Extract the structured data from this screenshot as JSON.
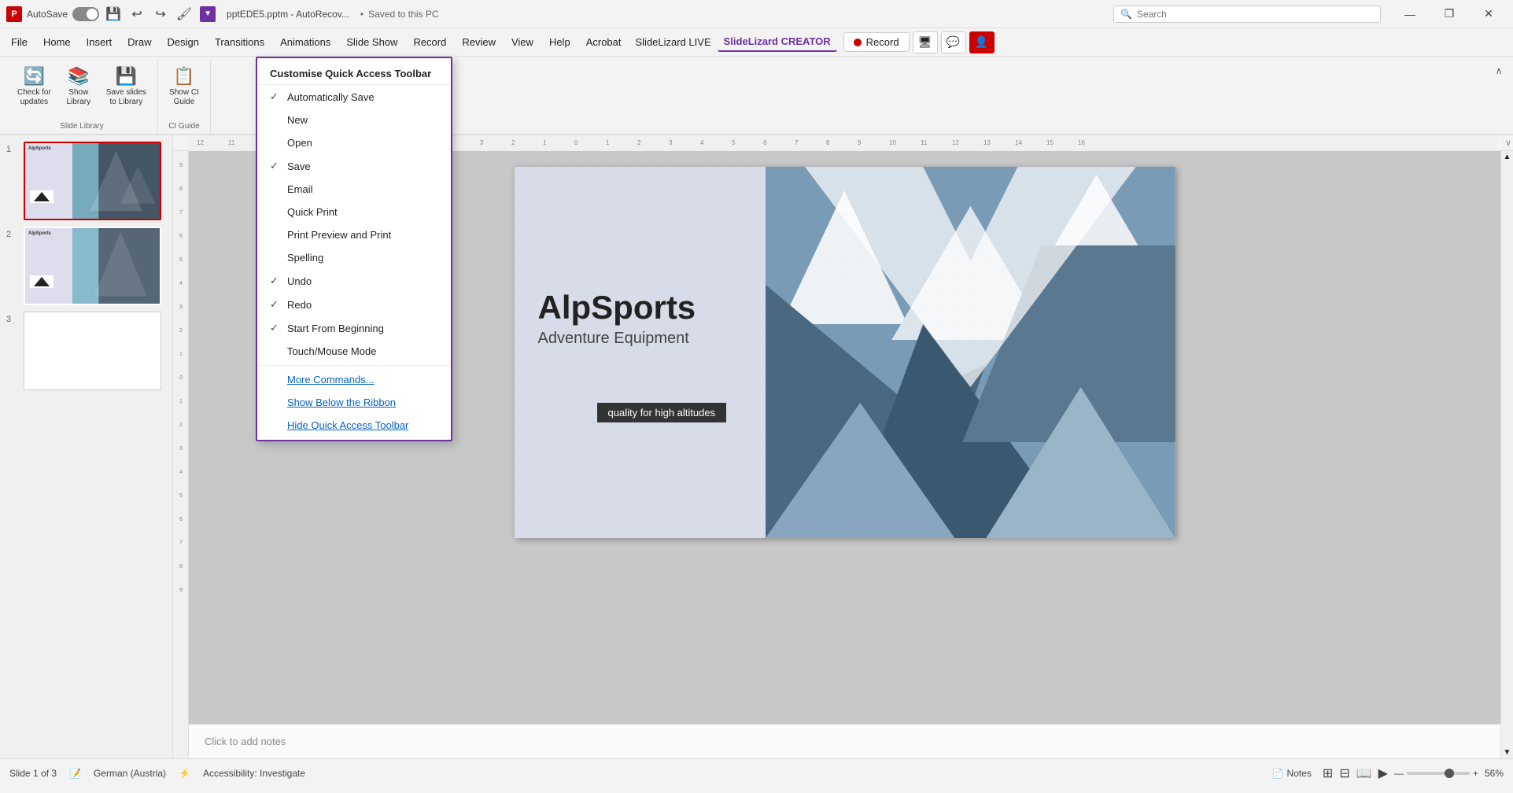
{
  "titleBar": {
    "appIcon": "P",
    "autosaveLabel": "AutoSave",
    "toggleState": "on",
    "saveIcon": "💾",
    "undoIcon": "↩",
    "redoIcon": "↪",
    "formatPainterIcon": "🖌",
    "dropdownIcon": "▼",
    "fileName": "pptEDE5.pptm - AutoRecov...",
    "separator": "•",
    "savedLabel": "Saved to this PC",
    "searchPlaceholder": "Search",
    "minimizeIcon": "—",
    "restoreIcon": "❐",
    "closeIcon": "✕"
  },
  "menuBar": {
    "items": [
      "File",
      "Home",
      "Insert",
      "Draw",
      "Design",
      "Transitions",
      "Animations",
      "Slide Show",
      "Record",
      "Review",
      "View",
      "Help",
      "Acrobat",
      "SlideLizard LIVE"
    ],
    "slideshow_label": "Slide Show",
    "slideLizardLive": "SlideLizard LIVE",
    "slideLizardCreator": "SlideLizard CREATOR",
    "recordBtn": "Record",
    "commentIcon": "💬",
    "shareIcon": "👤"
  },
  "ribbon": {
    "checkUpdates": {
      "icon": "🔄",
      "label": "Check for\nupdates"
    },
    "showLibrary": {
      "icon": "📚",
      "label": "Show\nLibrary"
    },
    "saveLibrary": {
      "icon": "💾",
      "label": "Save slides\nto Library"
    },
    "showCI": {
      "icon": "📋",
      "label": "Show CI\nGuide"
    },
    "group1Label": "Slide Library",
    "group2Label": "CI Guide",
    "collapseIcon": "∧"
  },
  "qaMenu": {
    "title": "Customise Quick Access Toolbar",
    "items": [
      {
        "label": "Automatically Save",
        "checked": true
      },
      {
        "label": "New",
        "checked": false
      },
      {
        "label": "Open",
        "checked": false
      },
      {
        "label": "Save",
        "checked": true
      },
      {
        "label": "Email",
        "checked": false
      },
      {
        "label": "Quick Print",
        "checked": false
      },
      {
        "label": "Print Preview and Print",
        "checked": false
      },
      {
        "label": "Spelling",
        "checked": false
      },
      {
        "label": "Undo",
        "checked": true
      },
      {
        "label": "Redo",
        "checked": true
      },
      {
        "label": "Start From Beginning",
        "checked": true
      },
      {
        "label": "Touch/Mouse Mode",
        "checked": false
      }
    ],
    "moreCommands": "More Commands...",
    "showBelow": "Show Below the Ribbon",
    "hideToolbar": "Hide Quick Access Toolbar"
  },
  "slides": [
    {
      "num": "1",
      "active": true
    },
    {
      "num": "2",
      "active": false
    },
    {
      "num": "3",
      "active": false,
      "blank": true
    }
  ],
  "slideContent": {
    "title": "AlpSports",
    "subtitle": "Adventure Equipment",
    "tagline": "quality for high altitudes"
  },
  "statusBar": {
    "slideInfo": "Slide 1 of 3",
    "language": "German (Austria)",
    "accessibility": "Accessibility: Investigate",
    "notes": "Notes",
    "zoomPercent": "56%",
    "zoomMinus": "—",
    "zoomPlus": "+"
  }
}
